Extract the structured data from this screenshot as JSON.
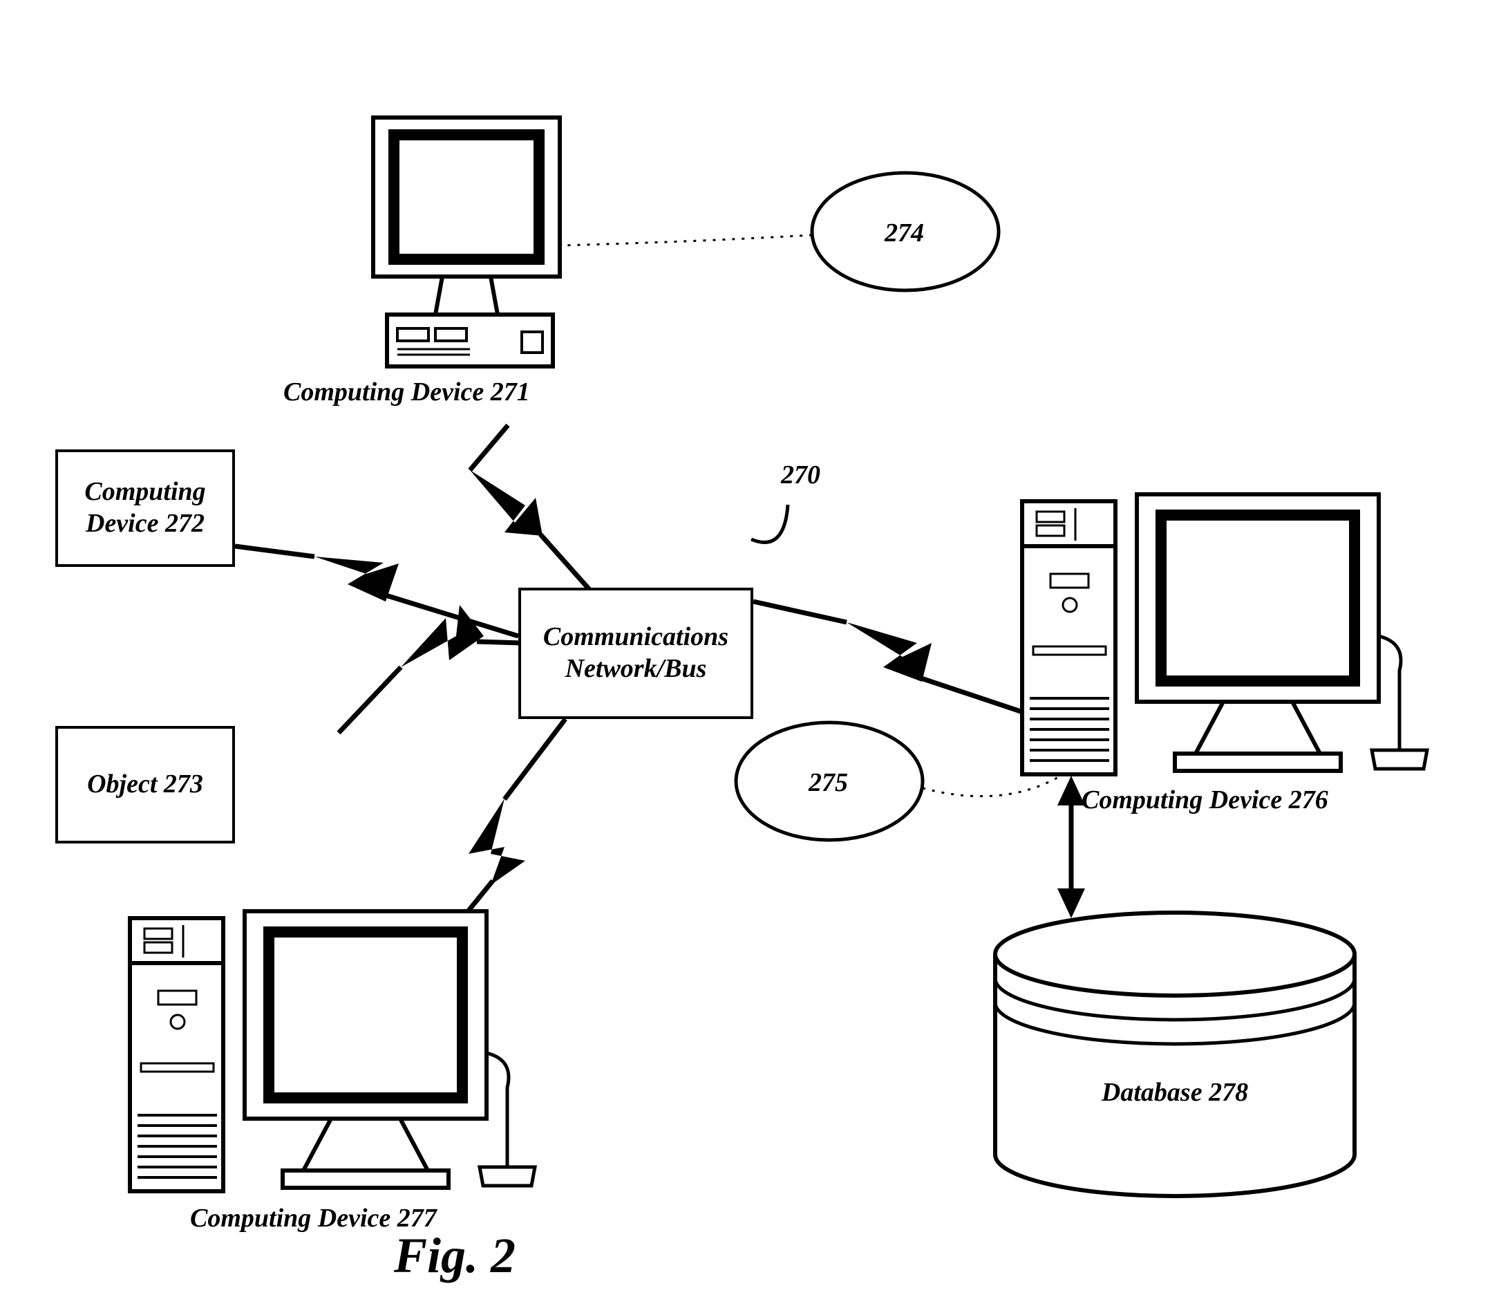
{
  "labels": {
    "device271": "Computing Device 271",
    "device272_l1": "Computing",
    "device272_l2": "Device 272",
    "object273": "Object 273",
    "device276": "Computing Device 276",
    "device277": "Computing Device 277",
    "database278": "Database 278",
    "ref270": "270",
    "ref274": "274",
    "ref275": "275",
    "commbus_l1": "Communications",
    "commbus_l2": "Network/Bus"
  },
  "figure_caption": "Fig. 2"
}
